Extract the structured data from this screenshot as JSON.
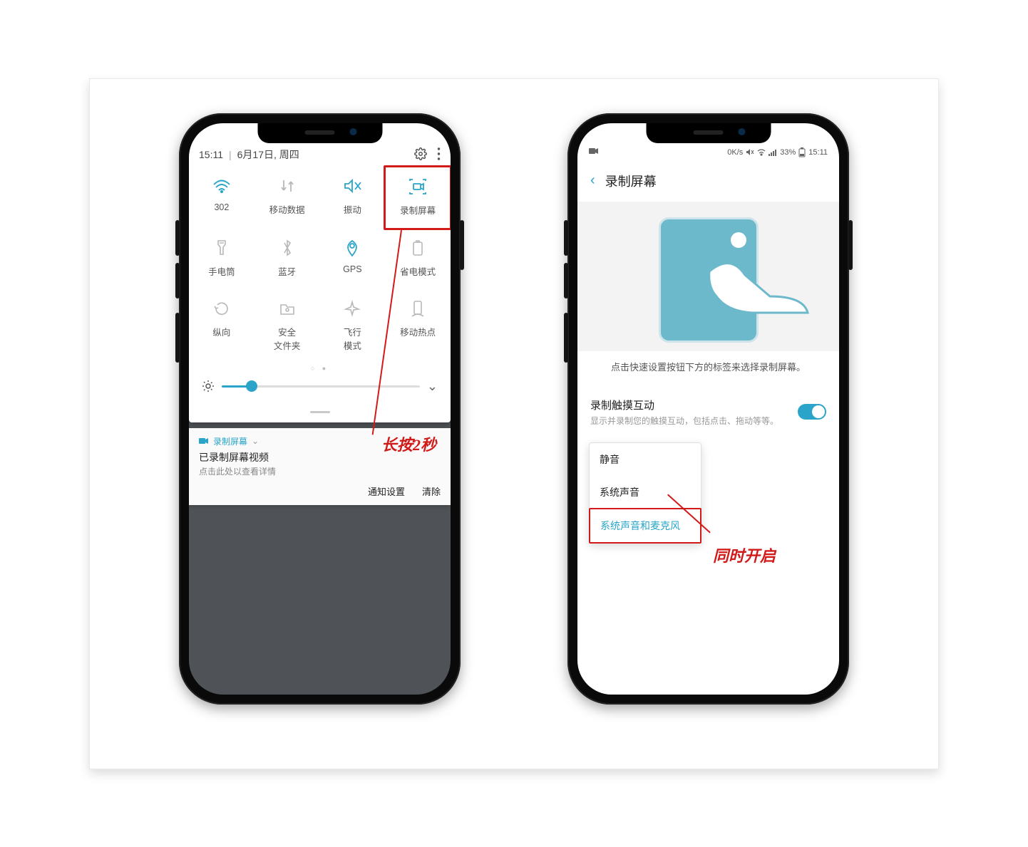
{
  "left": {
    "time": "15:11",
    "date": "6月17日, 周四",
    "tiles": [
      {
        "label": "302",
        "icon": "wifi",
        "active": true
      },
      {
        "label": "移动数据",
        "icon": "arrows",
        "active": false
      },
      {
        "label": "振动",
        "icon": "mute",
        "active": true
      },
      {
        "label": "录制屏幕",
        "icon": "record",
        "active": true
      },
      {
        "label": "手电筒",
        "icon": "torch",
        "active": false
      },
      {
        "label": "蓝牙",
        "icon": "bluetooth",
        "active": false
      },
      {
        "label": "GPS",
        "icon": "gps",
        "active": true
      },
      {
        "label": "省电模式",
        "icon": "battery",
        "active": false
      },
      {
        "label": "纵向",
        "icon": "rotate",
        "active": false
      },
      {
        "label": "安全\n文件夹",
        "icon": "folder",
        "active": false
      },
      {
        "label": "飞行\n模式",
        "icon": "airplane",
        "active": false
      },
      {
        "label": "移动热点",
        "icon": "hotspot",
        "active": false
      }
    ],
    "notif": {
      "app": "录制屏幕",
      "title": "已录制屏幕视频",
      "sub": "点击此处以查看详情",
      "action_settings": "通知设置",
      "action_clear": "清除"
    },
    "annotation": "长按2秒"
  },
  "right": {
    "status_speed": "0K/s",
    "status_battery": "33%",
    "status_time": "15:11",
    "page_title": "录制屏幕",
    "hint": "点击快速设置按钮下方的标签来选择录制屏幕。",
    "setting_title": "录制触摸互动",
    "setting_desc": "显示并录制您的触摸互动，包括点击、拖动等等。",
    "popup": {
      "opt1": "静音",
      "opt2": "系统声音",
      "opt3": "系统声音和麦克风"
    },
    "annotation": "同时开启"
  }
}
